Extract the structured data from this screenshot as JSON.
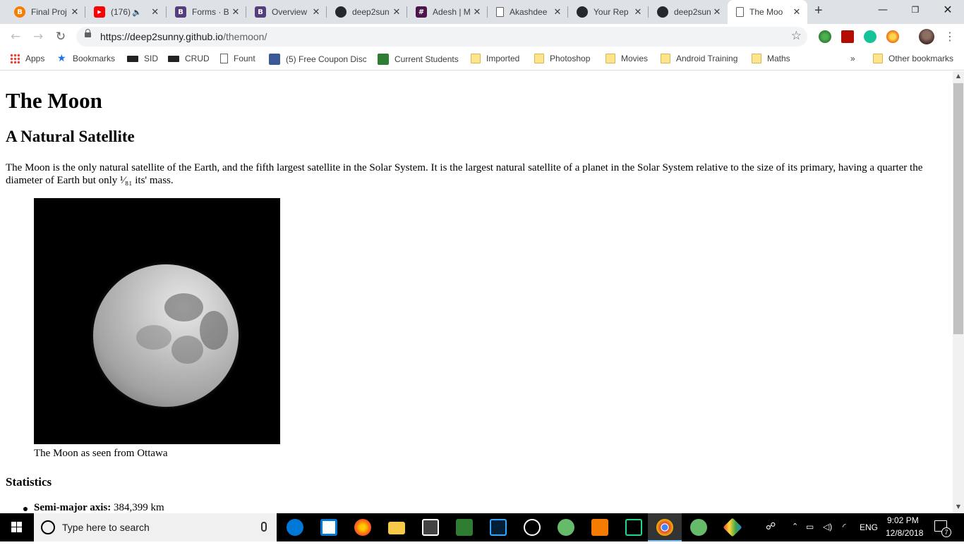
{
  "tabs": [
    {
      "title": "Final Proj",
      "icon": "blogger-icon",
      "icon_color": "#f57d00",
      "icon_glyph": "B"
    },
    {
      "title": "(176)",
      "icon": "youtube-icon",
      "icon_color": "#ff0000",
      "icon_glyph": "▶"
    },
    {
      "title": "Forms · B",
      "icon": "bootstrap-icon",
      "icon_color": "#563d7c",
      "icon_glyph": "B"
    },
    {
      "title": "Overview",
      "icon": "bootstrap-icon",
      "icon_color": "#563d7c",
      "icon_glyph": "B"
    },
    {
      "title": "deep2sun",
      "icon": "github-icon",
      "icon_color": "#24292e",
      "icon_glyph": "●"
    },
    {
      "title": "Adesh | M",
      "icon": "slack-icon",
      "icon_color": "#4a154b",
      "icon_glyph": "#"
    },
    {
      "title": "Akashdee",
      "icon": "page-icon",
      "icon_color": "#ffffff",
      "icon_glyph": ""
    },
    {
      "title": "Your Rep",
      "icon": "github-icon",
      "icon_color": "#24292e",
      "icon_glyph": "●"
    },
    {
      "title": "deep2sun",
      "icon": "github-icon",
      "icon_color": "#24292e",
      "icon_glyph": "●"
    },
    {
      "title": "The Moo",
      "icon": "page-icon",
      "icon_color": "#ffffff",
      "icon_glyph": ""
    }
  ],
  "address": {
    "host": "https://deep2sunny.github.io",
    "path": "/themoon/"
  },
  "bookmarks": {
    "items": [
      {
        "label": "Apps"
      },
      {
        "label": "Bookmarks"
      },
      {
        "label": "SID"
      },
      {
        "label": "CRUD"
      },
      {
        "label": "Fount"
      },
      {
        "label": "(5) Free Coupon Disc"
      },
      {
        "label": "Current Students"
      },
      {
        "label": "Imported"
      },
      {
        "label": "Photoshop"
      },
      {
        "label": "Movies"
      },
      {
        "label": "Android Training"
      },
      {
        "label": "Maths"
      }
    ],
    "overflow": "»",
    "other": "Other bookmarks"
  },
  "page": {
    "title": "The Moon",
    "subtitle": "A Natural Satellite",
    "intro": "The Moon is the only natural satellite of the Earth, and the fifth largest satellite in the Solar System. It is the largest natural satellite of a planet in the Solar System relative to the size of its primary, having a quarter the diameter of Earth but only ¹⁄₈₁ its' mass.",
    "caption": "The Moon as seen from Ottawa",
    "stats_heading": "Statistics",
    "stats": [
      {
        "label": "Semi-major axis:",
        "value": " 384,399 km"
      }
    ]
  },
  "taskbar": {
    "search_placeholder": "Type here to search",
    "lang": "ENG",
    "time": "9:02 PM",
    "date": "12/8/2018",
    "notifications": "7"
  }
}
